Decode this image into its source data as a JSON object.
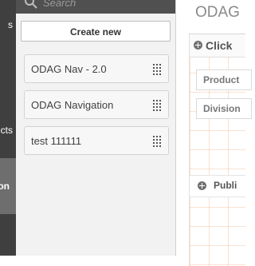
{
  "left_nav": {
    "items": [
      {
        "label": "s"
      },
      {
        "label": "cts"
      }
    ],
    "active_label": "on"
  },
  "search": {
    "placeholder": "Search"
  },
  "create_button": {
    "label": "Create new"
  },
  "list": [
    {
      "label": "ODAG Nav - 2.0"
    },
    {
      "label": "ODAG Navigation"
    },
    {
      "label": "test 111111"
    }
  ],
  "right": {
    "title": "ODAG",
    "click_row_label": "Click",
    "filters": [
      {
        "label": "Product"
      },
      {
        "label": "Division"
      }
    ],
    "publish_label": "Publi"
  }
}
